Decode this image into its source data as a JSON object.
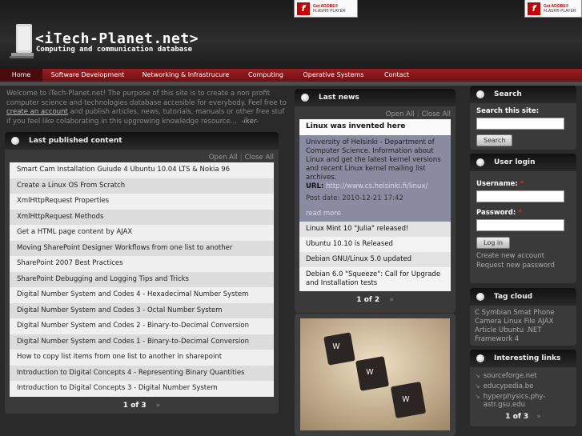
{
  "header": {
    "title": "<iTech-Planet.net>",
    "slogan": "Computing and communication database",
    "flash_badge": {
      "line1": "Get ADOBE®",
      "line2": "FLASH® PLAYER"
    }
  },
  "nav": [
    "Home",
    "Software Development",
    "Networking & Infrastrucure",
    "Computing",
    "Operative Systems",
    "Contact"
  ],
  "welcome": {
    "before": "Welcome to iTech-Planet.net! The purpose of this site is to create a non profit computer science and technologies database accesible for everybody. Feel free to ",
    "link": "create an account",
    "after": " and publish articles, news, tutorials, manuals or other free stuf if you feel like colaborating in this upgrowing knowledge resource...",
    "signature": "-iker-"
  },
  "published": {
    "title": "Last published content",
    "open_all": "Open All",
    "close_all": "Close All",
    "items": [
      "Smart Cam Installation Guiude 4 Ubuntu 10.04 LTS & Nokia 96",
      "Create a Linux OS From Scratch",
      "XmlHttpRequest Properties",
      "XmlHttpRequest Methods",
      "Get a HTML page content by AJAX",
      "Moving SharePoint Designer Workflows from one list to another",
      "SharePoint 2007 Best Practices",
      "SharePoint Debugging and Logging Tips and Tricks",
      "Digital Number System and Codes 4 - Hexadecimal Number System",
      "Digital Number System and Codes 3 - Octal Number System",
      "Digital Number System and Codes 2 - Binary-to-Decimal Conversion",
      "Digital Number System and Codes 1 - Binary-to-Decimal Conversion",
      "How to copy list items from one list to another in sharepoint",
      "Introduction to Digital Concepts 4 - Representing Binary Quantities",
      "Introduction to Digital Concepts 3 - Digital Number System"
    ],
    "pager": "1 of 3",
    "next": "»"
  },
  "news": {
    "title": "Last news",
    "open_all": "Open All",
    "close_all": "Close All",
    "first": {
      "title": "Linux was invented here",
      "body": "University of Helsinki - Department of Computer Science. Information about Linux and get the latest kernel versions and recent Linux kernel mailing list archives.",
      "url_label": "URL:",
      "url": "http://www.cs.helsinki.fi/linux/",
      "date": "Post date: 2010-12-21 17:42",
      "more": "read more"
    },
    "items": [
      "Linux Mint 10 \"Julia\" released!",
      "Ubuntu 10.10 is Released",
      "Debian GNU/Linux 5.0 updated",
      "Debian 6.0 \"Squeeze\": Call for Upgrade and Installation tests"
    ],
    "pager": "1 of 2",
    "next": "»"
  },
  "search": {
    "title": "Search",
    "label": "Search this site:",
    "button": "Search"
  },
  "login": {
    "title": "User login",
    "username_label": "Username:",
    "password_label": "Password:",
    "required": "*",
    "button": "Log in",
    "create_account": "Create new account",
    "request_password": "Request new password"
  },
  "tag_cloud": {
    "title": "Tag cloud",
    "tags": [
      "C",
      "Symbian",
      "Smat Phone",
      "Camera",
      "Linux",
      "File",
      "AJAX",
      "Article",
      "Ubuntu",
      ".NET",
      "Framework 4"
    ]
  },
  "links": {
    "title": "Interesting links",
    "items": [
      "sourceforge.net",
      "educypedia.be",
      "hyperphysics.phy-astr.gsu.edu"
    ],
    "pager": "1 of 3",
    "next": "»"
  },
  "colors": {
    "nav": "#8a161b",
    "panel": "#3a3a3a",
    "news_highlight": "#8a8aa0"
  }
}
